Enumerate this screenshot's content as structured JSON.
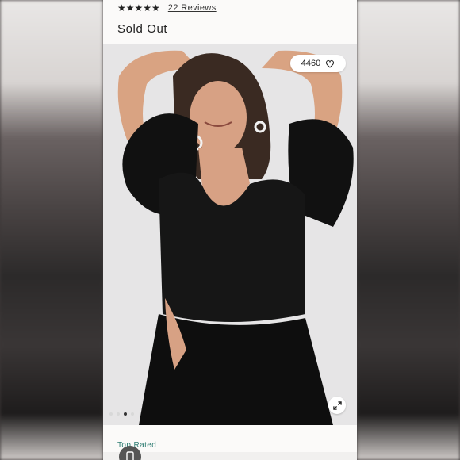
{
  "rating": {
    "stars": "★★★★★",
    "reviews_label": "22 Reviews"
  },
  "product": {
    "status": "Sold Out"
  },
  "gallery": {
    "favorite_count": "4460",
    "dots": [
      false,
      false,
      true,
      false
    ]
  },
  "footer": {
    "section_label": "Top Rated"
  }
}
